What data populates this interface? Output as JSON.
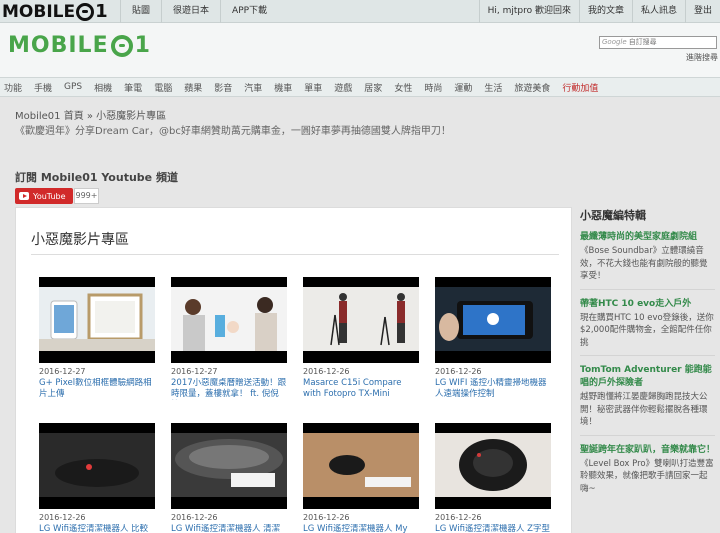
{
  "topbar": {
    "logo_left": "MOBILE",
    "logo_right": "1",
    "nav_left": [
      "貼圖",
      "很遊日本",
      "APP下載"
    ],
    "nav_right": [
      "Hi, mjtpro 歡迎回來",
      "我的文章",
      "私人訊息",
      "登出"
    ]
  },
  "header": {
    "logo_left": "MOBILE",
    "logo_right": "1",
    "search_brand": "Google",
    "search_placeholder": "自訂搜尋",
    "advanced_search": "進階搜尋"
  },
  "categories": [
    "功能",
    "手機",
    "GPS",
    "相機",
    "筆電",
    "電腦",
    "蘋果",
    "影音",
    "汽車",
    "機車",
    "單車",
    "遊戲",
    "居家",
    "女性",
    "時尚",
    "運動",
    "生活",
    "旅遊美食",
    "行動加值"
  ],
  "breadcrumb": "Mobile01 首頁 » 小惡魔影片專區",
  "promo": "《歡慶週年》分享Dream Car，@bc好車網贊助萬元購車金，一圓好車夢再抽德國雙人牌指甲刀！",
  "youtube": {
    "title": "訂閱 Mobile01 Youtube 頻道",
    "button": "YouTube",
    "count": "999+"
  },
  "content": {
    "title": "小惡魔影片專區",
    "videos": [
      {
        "date": "2016-12-27",
        "title": "G+ Pixel數位相框體驗網路相片上傳"
      },
      {
        "date": "2016-12-27",
        "title": "2017小惡魔桌曆贈送活動！跟時限量，蓋樓就拿！ ft. 倪倪怡君"
      },
      {
        "date": "2016-12-26",
        "title": "Masarce C15i Compare with Fotopro TX-Mini"
      },
      {
        "date": "2016-12-26",
        "title": "LG WIFI 遙控小精靈掃地機器人遠端操作控制"
      },
      {
        "date": "2016-12-26",
        "title": "LG Wifi遙控清潔機器人 比較不"
      },
      {
        "date": "2016-12-26",
        "title": "LG Wifi遙控清潔機器人 清潔沙"
      },
      {
        "date": "2016-12-26",
        "title": "LG Wifi遙控清潔機器人 My"
      },
      {
        "date": "2016-12-26",
        "title": "LG Wifi遙控清潔機器人 Z字型"
      }
    ]
  },
  "sidebar": {
    "title": "小惡魔編特輯",
    "items": [
      {
        "headline": "最纖薄時尚的美型家庭劇院組",
        "desc": "《Bose Soundbar》立體環繞音效，不花大錢也能有劇院般的聽覺享受！"
      },
      {
        "headline": "帶著HTC 10 evo走入戶外",
        "desc": "現在購買HTC 10 evo登錄後，送你$2,000配件購物金，全館配件任你挑"
      },
      {
        "headline": "TomTom Adventurer 能跑能唱的戶外探險者",
        "desc": "越野跑懂將江晏慶歸胸跑昆技大公開！秘密武器伴你輕鬆擺脫各種環境！"
      },
      {
        "headline": "聖誕跨年在家趴趴，音樂就靠它！",
        "desc": "《Level Box Pro》雙喇叭打造豐富聆聽效果，就像把歌手請回家一起嗨~"
      }
    ]
  },
  "colors": {
    "brand_green": "#49a54a",
    "link_blue": "#2d6fae",
    "youtube_red": "#d12a2a",
    "promo_red": "#c12a2a"
  }
}
